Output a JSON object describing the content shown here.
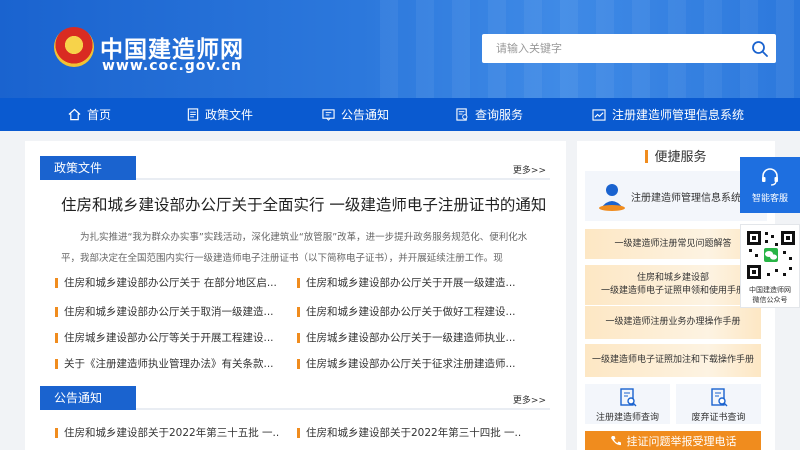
{
  "header": {
    "site_name": "中国建造师网",
    "site_url": "www.coc.gov.cn",
    "search_placeholder": "请输入关键字"
  },
  "nav": {
    "items": [
      {
        "label": "首页",
        "icon": "home-icon"
      },
      {
        "label": "政策文件",
        "icon": "document-icon"
      },
      {
        "label": "公告通知",
        "icon": "notice-icon"
      },
      {
        "label": "查询服务",
        "icon": "query-icon"
      },
      {
        "label": "注册建造师管理信息系统",
        "icon": "chart-icon"
      }
    ]
  },
  "policy": {
    "title": "政策文件",
    "more": "更多>>",
    "headline": "住房和城乡建设部办公厅关于全面实行 一级建造师电子注册证书的通知",
    "summary": "为扎实推进“我为群众办实事”实践活动，深化建筑业“放管服”改革，进一步提升政务服务规范化、便利化水平，我部决定在全国范围内实行一级建造师电子注册证书（以下简称电子证书），并开展延续注册工作。现",
    "items": [
      "住房和城乡建设部办公厅关于 在部分地区启...",
      "住房和城乡建设部办公厅关于开展一级建造...",
      "住房和城乡建设部办公厅关于取消一级建造...",
      "住房和城乡建设部办公厅关于做好工程建设...",
      "住房城乡建设部办公厅等关于开展工程建设...",
      "住房城乡建设部办公厅关于一级建造师执业...",
      "关于《注册建造师执业管理办法》有关条款...",
      "住房城乡建设部办公厅关于征求注册建造师..."
    ]
  },
  "notice": {
    "title": "公告通知",
    "more": "更多>>",
    "items": [
      "住房和城乡建设部关于2022年第三十五批 一...",
      "住房和城乡建设部关于2022年第三十四批 一..."
    ]
  },
  "sidebar": {
    "title": "便捷服务",
    "system_label": "注册建造师管理信息系统",
    "guides": [
      "一级建造师注册常见问题解答",
      "住房和城乡建设部\n一级建造师电子证照申领和使用手册",
      "一级建造师注册业务办理操作手册",
      "一级建造师电子证照加注和下载操作手册"
    ],
    "tiles": [
      {
        "label": "注册建造师查询",
        "icon": "search-doc-icon"
      },
      {
        "label": "废弃证书查询",
        "icon": "search-cert-icon"
      }
    ],
    "report_label": "挂证问题举报受理电话"
  },
  "float": {
    "service_label": "智能客服",
    "qr_caption_1": "中国建造师网",
    "qr_caption_2": "微信公众号"
  },
  "colors": {
    "primary": "#1a63cf",
    "nav": "#0a5ad0",
    "accent": "#f08c1e"
  }
}
